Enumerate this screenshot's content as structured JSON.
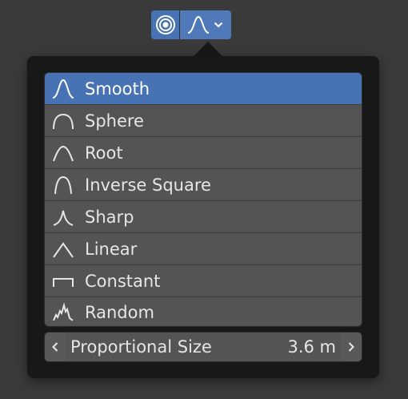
{
  "header": {
    "proportional_toggle_icon": "proportional-editing-icon",
    "falloff_dropdown_icon": "smooth-falloff-icon",
    "chevron_icon": "chevron-down-icon"
  },
  "falloff_menu": {
    "items": [
      {
        "label": "Smooth",
        "icon": "smooth-falloff-icon",
        "selected": true
      },
      {
        "label": "Sphere",
        "icon": "sphere-falloff-icon",
        "selected": false
      },
      {
        "label": "Root",
        "icon": "root-falloff-icon",
        "selected": false
      },
      {
        "label": "Inverse Square",
        "icon": "inverse-square-falloff-icon",
        "selected": false
      },
      {
        "label": "Sharp",
        "icon": "sharp-falloff-icon",
        "selected": false
      },
      {
        "label": "Linear",
        "icon": "linear-falloff-icon",
        "selected": false
      },
      {
        "label": "Constant",
        "icon": "constant-falloff-icon",
        "selected": false
      },
      {
        "label": "Random",
        "icon": "random-falloff-icon",
        "selected": false
      }
    ]
  },
  "proportional_size": {
    "label": "Proportional Size",
    "value": "3.6 m"
  },
  "colors": {
    "accent": "#4772b3",
    "item_bg": "#545454",
    "panel_bg": "#181818",
    "window_bg": "#3a3a3a"
  }
}
